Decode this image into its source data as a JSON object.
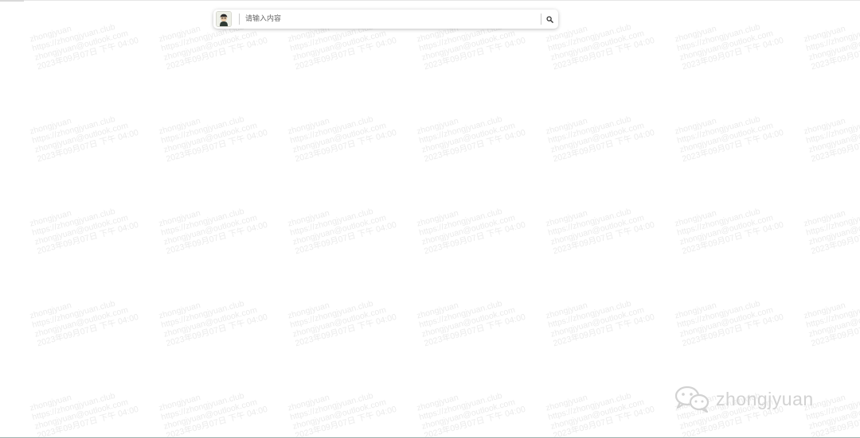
{
  "search": {
    "placeholder": "请输入内容",
    "value": ""
  },
  "watermark": {
    "lines": [
      "zhongjyuan",
      "https://zhongjyuan.club",
      "zhongjyuan@outlook.com",
      "2023年09月07日 下午 04:00"
    ]
  },
  "brand": {
    "text": "zhongjyuan"
  },
  "icons": {
    "avatar": "avatar-icon",
    "search": "search-icon",
    "wechat": "wechat-icon"
  },
  "colors": {
    "watermark": "#969696",
    "brand_text": "#d2d2d2",
    "search_shadow": "#bfbfbf"
  }
}
